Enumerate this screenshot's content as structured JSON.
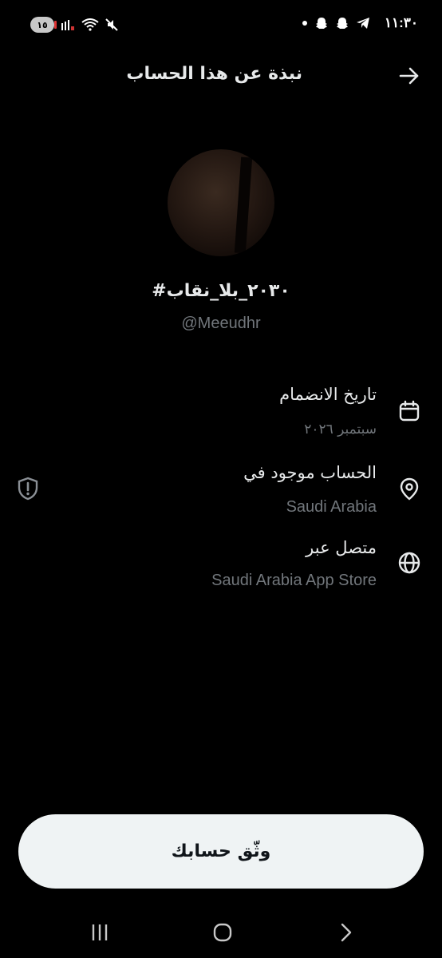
{
  "status_bar": {
    "time": "١١:٣٠",
    "battery": "١٥"
  },
  "header": {
    "title": "نبذة عن هذا الحساب"
  },
  "profile": {
    "display_name": "#٢٠٣٠_بلا_نقاب",
    "username": "@Meeudhr"
  },
  "info": {
    "joined_label": "تاريخ الانضمام",
    "joined_value": "سبتمبر ٢٠٢٦",
    "location_label": "الحساب موجود في",
    "location_value": "Saudi Arabia",
    "connected_label": "متصل عبر",
    "connected_value": "Saudi Arabia App Store"
  },
  "verify_button": {
    "label": "وثّق حسابك"
  },
  "icons": {
    "back": "arrow-right-icon",
    "joined": "calendar-icon",
    "location": "location-pin-icon",
    "connected": "globe-icon",
    "privacy": "shield-alert-icon"
  },
  "colors": {
    "background": "#000000",
    "text_primary": "#e7e9ea",
    "text_secondary": "#71767b",
    "button_bg": "#eff3f4",
    "button_text": "#0f1419"
  }
}
